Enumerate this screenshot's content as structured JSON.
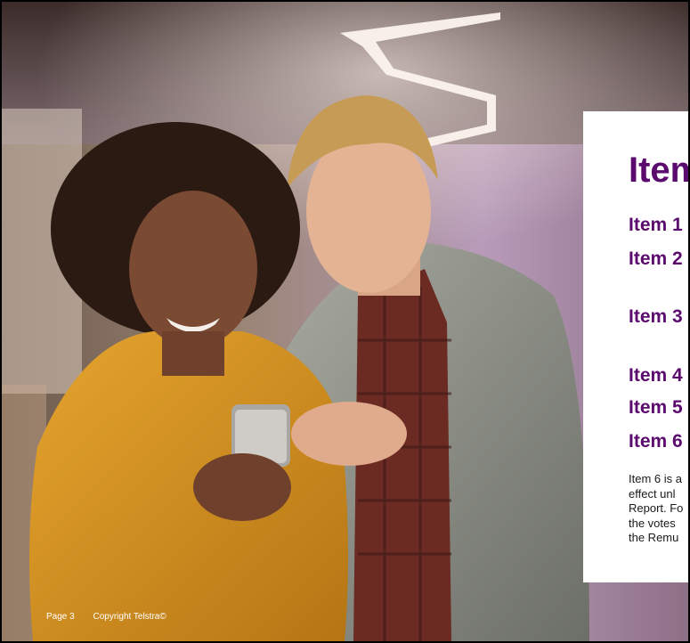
{
  "card": {
    "title": "Item",
    "items": [
      "Item 1",
      "Item 2",
      "Item 3",
      "Item 4",
      "Item 5",
      "Item 6"
    ],
    "note_lines": [
      "Item 6 is a",
      "effect unl",
      "Report. Fo",
      "the votes",
      "the Remu"
    ]
  },
  "footer": {
    "page": "Page 3",
    "copyright": "Copyright Telstra©"
  },
  "colors": {
    "accent": "#5b0a6e",
    "card_background": "#ffffff"
  },
  "image": {
    "description_icon": "photo-two-people-looking-at-phone"
  }
}
